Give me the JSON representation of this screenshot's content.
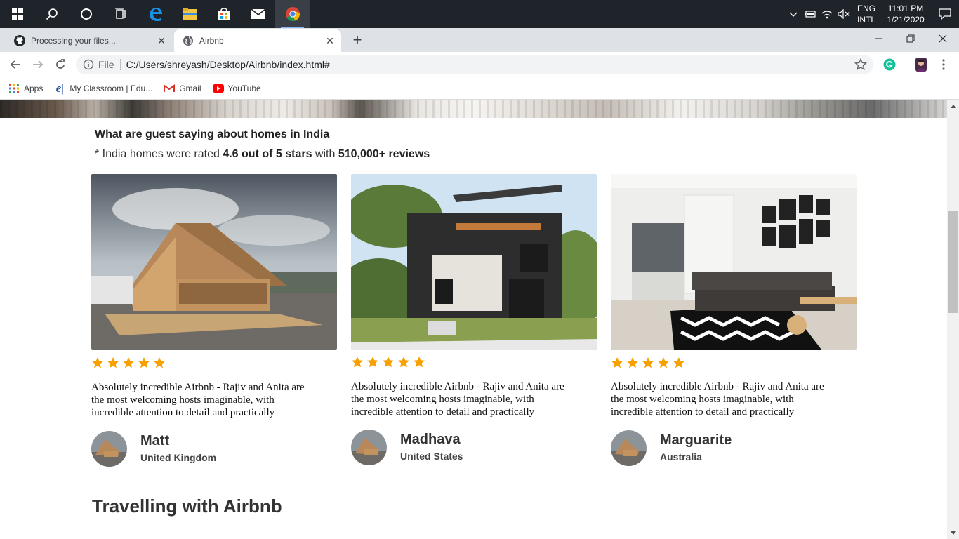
{
  "taskbar": {
    "apps": [
      "start-icon",
      "search-icon",
      "cortana-icon",
      "task-view-icon",
      "edge-icon",
      "file-explorer-icon",
      "store-icon",
      "mail-icon",
      "chrome-icon"
    ],
    "lang_top": "ENG",
    "lang_bottom": "INTL",
    "time": "11:01 PM",
    "date": "1/21/2020"
  },
  "browser": {
    "tabs": [
      {
        "title": "Processing your files...",
        "icon": "github-icon"
      },
      {
        "title": "Airbnb",
        "icon": "globe-icon"
      }
    ],
    "address": {
      "scheme": "File",
      "url": "C:/Users/shreyash/Desktop/Airbnb/index.html#"
    },
    "bookmarks": [
      {
        "label": "Apps",
        "icon": "apps-grid-icon"
      },
      {
        "label": "My Classroom | Edu...",
        "icon": "edureka-icon"
      },
      {
        "label": "Gmail",
        "icon": "gmail-icon"
      },
      {
        "label": "YouTube",
        "icon": "youtube-icon"
      }
    ]
  },
  "page": {
    "section_heading": "What are guest saying about homes in India",
    "rating": {
      "prefix": "* India homes were rated ",
      "score": "4.6 out of 5 stars",
      "middle": " with ",
      "reviews": "510,000+ reviews"
    },
    "star_color": "#f7a100",
    "cards": [
      {
        "stars": 5,
        "review": "Absolutely incredible Airbnb - Rajiv and Anita are the most welcoming hosts imaginable, with incredible attention to detail and practically",
        "name": "Matt",
        "country": "United Kingdom"
      },
      {
        "stars": 5,
        "review": "Absolutely incredible Airbnb - Rajiv and Anita are the most welcoming hosts imaginable, with incredible attention to detail and practically",
        "name": "Madhava",
        "country": "United States"
      },
      {
        "stars": 5,
        "review": "Absolutely incredible Airbnb - Rajiv and Anita are the most welcoming hosts imaginable, with incredible attention to detail and practically",
        "name": "Marguarite",
        "country": "Australia"
      }
    ],
    "next_heading": "Travelling with Airbnb"
  }
}
